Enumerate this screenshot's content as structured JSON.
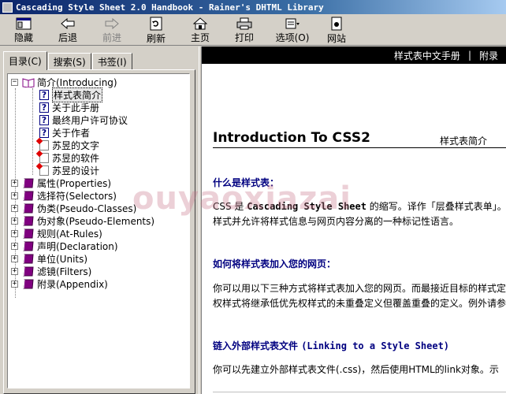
{
  "window": {
    "title": "Cascading Style Sheet 2.0 Handbook - Rainer's DHTML Library"
  },
  "toolbar": {
    "hide": "隐藏",
    "back": "后退",
    "forward": "前进",
    "refresh": "刷新",
    "home": "主页",
    "print": "打印",
    "options": "选项(O)",
    "website": "网站"
  },
  "tabs": {
    "contents": "目录(C)",
    "search": "搜索(S)",
    "bookmarks": "书签(I)"
  },
  "tree": {
    "intro": "简介(Introducing)",
    "intro_children": [
      "样式表简介",
      "关于此手册",
      "最终用户许可协议",
      "关于作者"
    ],
    "software_children": [
      "苏昱的文字",
      "苏昱的软件",
      "苏昱的设计"
    ],
    "sections": [
      "属性(Properties)",
      "选择符(Selectors)",
      "伪类(Pseudo-Classes)",
      "伪对象(Pseudo-Elements)",
      "规则(At-Rules)",
      "声明(Declaration)",
      "单位(Units)",
      "滤镜(Filters)",
      "附录(Appendix)"
    ]
  },
  "nav": {
    "manual": "样式表中文手册",
    "sep": "|",
    "appendix": "附录"
  },
  "doc": {
    "title": "Introduction To CSS2",
    "crumb": "样式表简介",
    "h1": "什么是样式表：",
    "p1a_1": "CSS 是 ",
    "p1a_bold": "Cascading Style Sheet",
    "p1a_2": " 的缩写。译作「层叠样式表单」。",
    "p1b": "样式并允许将样式信息与网页内容分离的一种标记性语言。",
    "h2": "如何将样式表加入您的网页：",
    "p2a": "你可以用以下三种方式将样式表加入您的网页。而最接近目标的样式定",
    "p2b": "权样式将继承低优先权样式的未重叠定义但覆盖重叠的定义。例外请参",
    "h3_cn": "链入外部样式表文件 ",
    "h3_en": "(Linking to a Style Sheet)",
    "p3": "你可以先建立外部样式表文件(.css)，然后使用HTML的link对象。示"
  },
  "watermark": "ouyaoxiazai",
  "colors": {
    "title_bar": "#0a246a",
    "heading": "#000080",
    "nav_bar": "#000000"
  }
}
